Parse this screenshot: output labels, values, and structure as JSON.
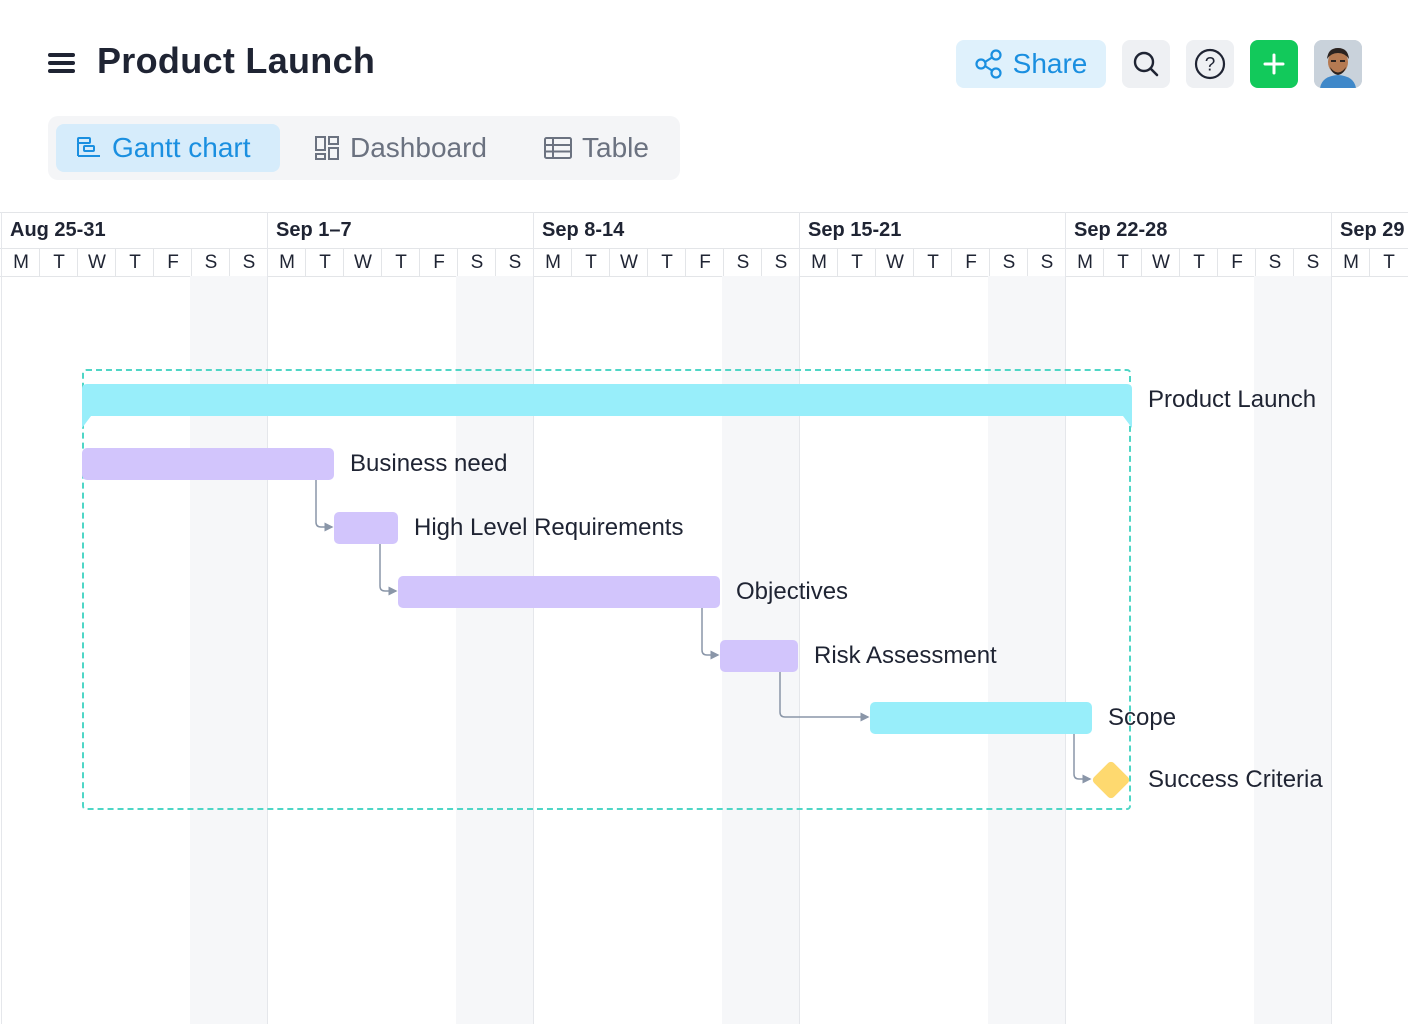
{
  "header": {
    "title": "Product Launch",
    "share_label": "Share",
    "icons": [
      "menu-icon",
      "share-icon",
      "search-icon",
      "help-icon",
      "plus-icon"
    ],
    "accent_color": "#1a8fe0",
    "add_color": "#12c95b"
  },
  "tabs": [
    {
      "label": "Gantt chart",
      "icon": "gantt-icon",
      "active": true
    },
    {
      "label": "Dashboard",
      "icon": "dashboard-icon",
      "active": false
    },
    {
      "label": "Table",
      "icon": "table-icon",
      "active": false
    }
  ],
  "timeline": {
    "weeks": [
      "Aug 25-31",
      "Sep 1–7",
      "Sep 8-14",
      "Sep 15-21",
      "Sep 22-28",
      "Sep 29"
    ],
    "days": [
      "M",
      "T",
      "W",
      "T",
      "F",
      "S",
      "S",
      "M",
      "T",
      "W",
      "T",
      "F",
      "S",
      "S",
      "M",
      "T",
      "W",
      "T",
      "F",
      "S",
      "S",
      "M",
      "T",
      "W",
      "T",
      "F",
      "S",
      "S",
      "M",
      "T",
      "W",
      "T",
      "F",
      "S",
      "S",
      "M",
      "T"
    ]
  },
  "tasks": {
    "group": {
      "name": "Product Launch",
      "start": "Aug 27",
      "end": "Sep 23",
      "color": "#98eefa"
    },
    "items": [
      {
        "name": "Business need",
        "start": "Aug 27",
        "end": "Sep 2",
        "color": "#d2c5fc"
      },
      {
        "name": "High Level Requirements",
        "start": "Sep 2",
        "end": "Sep 3",
        "color": "#d2c5fc"
      },
      {
        "name": "Objectives",
        "start": "Sep 4",
        "end": "Sep 11",
        "color": "#d2c5fc"
      },
      {
        "name": "Risk Assessment",
        "start": "Sep 12",
        "end": "Sep 13",
        "color": "#d2c5fc"
      },
      {
        "name": "Scope",
        "start": "Sep 16",
        "end": "Sep 21",
        "color": "#98eefa"
      }
    ],
    "milestone": {
      "name": "Success Criteria",
      "date": "Sep 22",
      "color": "#fed96f"
    }
  }
}
